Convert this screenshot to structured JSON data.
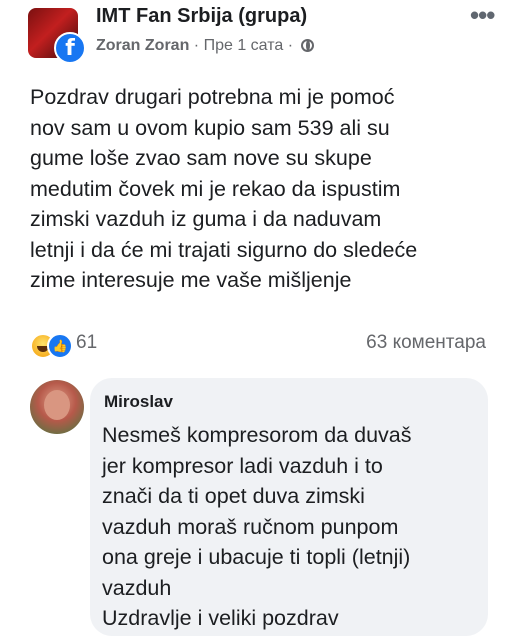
{
  "post": {
    "group_name": "IMT Fan Srbija (grupa)",
    "author": "Zoran Zoran",
    "separator": "·",
    "time": "Пре 1 сата",
    "separator2": "·",
    "body_lines": [
      "Pozdrav drugari potrebna mi je pomoć",
      "nov sam u ovom kupio sam 539 ali su",
      "gume loše zvao sam nove su skupe",
      "medutim čovek mi je rekao da ispustim",
      "zimski vazduh iz guma i da naduvam",
      "letnji i da će mi trajati sigurno do sledeće",
      "zime  interesuje me vaše mišljenje"
    ],
    "reaction_count": "61",
    "comment_count": "63 коментара"
  },
  "comment": {
    "author": "Miroslav",
    "lines": [
      "Nesmeš kompresorom da duvaš",
      "jer kompresor ladi vazduh i to",
      "znači da ti opet duva zimski",
      "vazduh moraš ručnom punpom",
      "ona greje i ubacuje ti topli (letnji)",
      "vazduh",
      "Uzdravlje i veliki pozdrav"
    ]
  },
  "icons": {
    "facebook_badge": "f",
    "menu": "•••",
    "like": "👍"
  },
  "colors": {
    "facebook_blue": "#1877f2",
    "bubble_bg": "#f0f2f5",
    "meta_gray": "#65676b"
  }
}
